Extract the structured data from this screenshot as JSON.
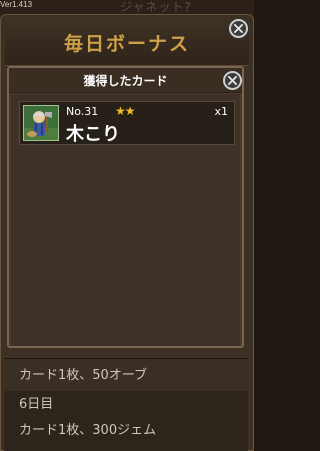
{
  "version": "Ver1.413",
  "header": {
    "title": "毎日ボーナス",
    "behind_text": "ジャネット?"
  },
  "background_list": [
    {
      "text": "カード1枚、50オーブ"
    },
    {
      "text": "6日目"
    },
    {
      "text": "カード1枚、300ジェム"
    }
  ],
  "modal": {
    "title": "獲得したカード",
    "card": {
      "number": "No.31",
      "stars": "★★",
      "count": "x1",
      "name": "木こり"
    }
  },
  "colors": {
    "title_gold": "#cfa04a",
    "star_gold": "#f0c020",
    "panel_brown": "#3c2f24"
  },
  "icons": {
    "close": "close-icon",
    "card_art": "lumberjack-portrait"
  }
}
